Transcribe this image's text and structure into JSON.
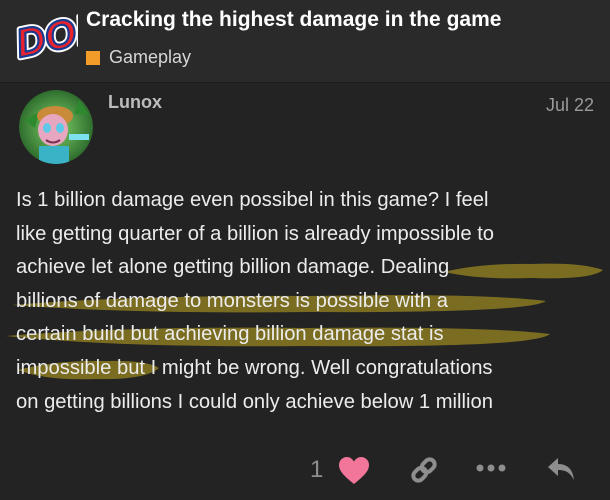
{
  "topic": {
    "title": "Cracking the highest damage in the game",
    "category": "Gameplay",
    "category_color": "#f39c29",
    "logo_text": "DO!"
  },
  "post": {
    "username": "Lunox",
    "date": "Jul 22",
    "lines": [
      "Is 1 billion damage even possibel in this game? I feel",
      "like getting quarter of a billion is already impossible to",
      "achieve let alone getting billion damage. Dealing",
      "billions of damage to monsters is possible with a",
      "certain build but achieving billion damage stat is",
      "impossible but I might be wrong. Well congratulations",
      "on getting billions I could only achieve below 1 million"
    ],
    "highlight_color": "#8a7a22"
  },
  "actions": {
    "like_count": "1",
    "like_icon": "heart-icon",
    "share_icon": "link-icon",
    "more_icon": "more-icon",
    "reply_icon": "reply-icon"
  }
}
